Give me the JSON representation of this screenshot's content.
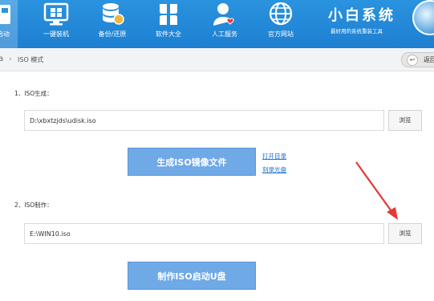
{
  "nav": {
    "items": [
      {
        "label": "启动",
        "icon": "usb-drive-icon"
      },
      {
        "label": "一键装机",
        "icon": "monitor-windows-icon"
      },
      {
        "label": "备份/还原",
        "icon": "database-icon"
      },
      {
        "label": "软件大全",
        "icon": "clover-apps-icon"
      },
      {
        "label": "人工服务",
        "icon": "person-heart-icon"
      },
      {
        "label": "官方网站",
        "icon": "globe-icon"
      }
    ],
    "brand_title": "小白系统",
    "brand_subtitle": "最好用的系统重装工具"
  },
  "subbar": {
    "home_fragment": "a",
    "breadcrumb": "ISO 模式",
    "back_label": "返回"
  },
  "iso_generate": {
    "section_label": "1、ISO生成：",
    "path_value": "D:\\xbxtzjds\\udisk.iso",
    "browse_label": "浏览",
    "generate_button": "生成ISO镜像文件",
    "open_dir_link": "打开目录",
    "burn_disc_link": "刻录光盘"
  },
  "iso_make": {
    "section_label": "2、ISO制作：",
    "path_value": "E:\\WIN10.iso",
    "browse_label": "浏览",
    "make_button": "制作ISO启动U盘"
  },
  "colors": {
    "topbar": "#2a93df",
    "primary_button": "#6fa9e6",
    "link": "#1e6fd0",
    "annotation_arrow": "#e53935"
  }
}
